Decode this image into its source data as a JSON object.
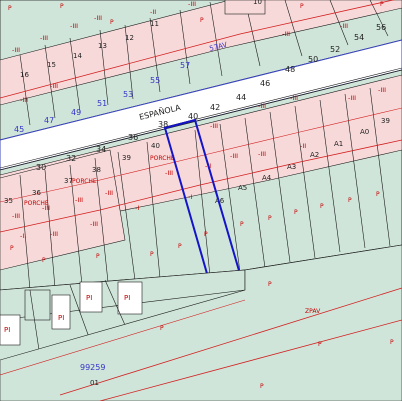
{
  "colors": {
    "green_zone": "#cfe5d9",
    "pink_zone": "#f8d9d9",
    "road": "#ffffff",
    "black_line": "#1a1a1a",
    "red_line": "#d21e1e",
    "blue_line": "#3b45b8",
    "blue_highlight": "#1414c8",
    "red_text": "#c40000",
    "blue_text": "#3434c8",
    "dark_text": "#222222"
  },
  "street": {
    "name": "ESPAÑOLA",
    "zone_code": "ZPAV",
    "zone_code_upper": "57AV"
  },
  "sector": {
    "code": "99259",
    "sub": "01"
  },
  "numbers_north_upper": [
    "45",
    "47",
    "49",
    "51",
    "53",
    "55",
    "57"
  ],
  "numbers_north_lower": [
    "36",
    "38",
    "40",
    "42",
    "44",
    "46",
    "48",
    "50",
    "52",
    "54",
    "56"
  ],
  "numbers_south": [
    "30",
    "32",
    "34",
    "36",
    "38"
  ],
  "parcel_top_labels": [
    "10",
    "11",
    "12",
    "13",
    "14",
    "15",
    "16"
  ],
  "parcel_mid_labels": [
    "35",
    "36",
    "37",
    "38",
    "39",
    "40",
    "A0",
    "39",
    "A1",
    "A2",
    "A3",
    "A4",
    "A5",
    "A6"
  ],
  "floor_labels": {
    "three": "-III",
    "two": "-II",
    "one": "-I",
    "plus_three": "+III",
    "p": "P",
    "pi": "PI",
    "i": "I"
  },
  "tags": [
    "PORCHE",
    "PORCHE",
    "PORCHE"
  ]
}
